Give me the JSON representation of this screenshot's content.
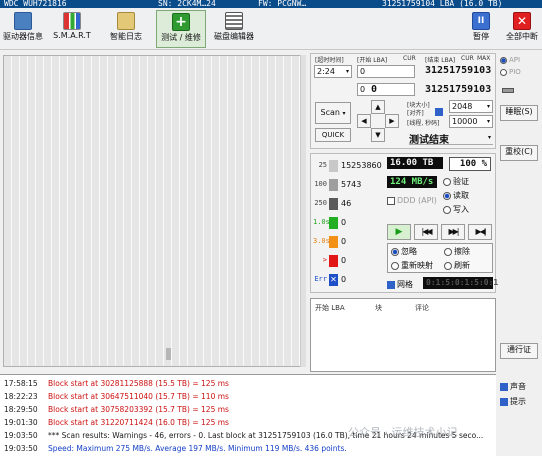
{
  "infobar": {
    "model": "WDC WUH721816",
    "sn": "SN: 2CK4M…24",
    "fw": "FW: PCGNW…",
    "capacity": "31251759104 LBA (16.0 TB)"
  },
  "toolbar": {
    "buttons": [
      {
        "label": "驱动器信息",
        "icon": "drive-info-icon"
      },
      {
        "label": "S.M.A.R.T",
        "icon": "smart-icon"
      },
      {
        "label": "智能日志",
        "icon": "log-icon"
      },
      {
        "label": "测试 / 维修",
        "icon": "test-repair-icon"
      },
      {
        "label": "磁盘编辑器",
        "icon": "disk-editor-icon"
      },
      {
        "label": "暂停",
        "icon": "pause-icon"
      },
      {
        "label": "全部中断",
        "icon": "stop-icon"
      }
    ]
  },
  "controls": {
    "timeout_label": "[超时时间]",
    "timeout_value": "2:24",
    "start_lba_label": "[开始 LBA]",
    "start_lba_value": "0",
    "start_lba_zero": "0",
    "end_lba_label": "[结束 LBA]",
    "end_lba_value": "31251759103",
    "end_lba_readout": "31251759103",
    "start_lba_readout": "0",
    "cur_label": "CUR",
    "max_label": "MAX",
    "scan_button": "Scan",
    "quick_button": "QUICK",
    "block_size_label": "[块大小]",
    "align_label": "[对齐]",
    "block_size_value": "2048",
    "threads_label": "[线程, 秒码]",
    "threads_value": "10000",
    "status_text": "测试结束"
  },
  "stats": {
    "capacity_readout": "16.00 TB",
    "percent_readout": "100 %",
    "speed_readout": "124 MB/s",
    "legend": [
      {
        "label": "25",
        "value": "15253860",
        "color": "#c8c8c8"
      },
      {
        "label": "100",
        "value": "5743",
        "color": "#9e9e9e"
      },
      {
        "label": "250",
        "value": "46",
        "color": "#5a5a5a"
      },
      {
        "label": "1.0s",
        "value": "0",
        "color": "#22b022"
      },
      {
        "label": "3.0s",
        "value": "0",
        "color": "#f29018"
      },
      {
        "label": ">",
        "value": "0",
        "color": "#e01818"
      },
      {
        "label": "Err",
        "value": "0",
        "color": "#1f4fc8"
      }
    ],
    "mode_verify": "验证",
    "mode_read": "读取",
    "mode_write": "写入",
    "ddd_label": "DDD (API)"
  },
  "repair": {
    "ignore": "忽略",
    "erase": "擦除",
    "remap": "重新映射",
    "refresh": "刷新",
    "grid_label": "网格",
    "grid_readout": "0:1:5:0:1:5:0:1"
  },
  "table": {
    "col_lba": "开始 LBA",
    "col_block": "块",
    "col_note": "评论"
  },
  "side": {
    "api_label": "API",
    "pio_label": "PIO",
    "sleep_button": "睡眠(S)",
    "recal_button": "重校(C)",
    "passport_button": "通行证",
    "sound_label": "声音",
    "hints_label": "提示"
  },
  "log": [
    {
      "time": "17:58:15",
      "msg": "Block start at 30281125888 (15.5 TB)  = 125 ms",
      "kind": "warn"
    },
    {
      "time": "18:22:23",
      "msg": "Block start at 30647511040 (15.7 TB)  = 110 ms",
      "kind": "warn"
    },
    {
      "time": "18:29:50",
      "msg": "Block start at 30758203392 (15.7 TB)  = 125 ms",
      "kind": "warn"
    },
    {
      "time": "19:01:30",
      "msg": "Block start at 31220711424 (16.0 TB)  = 125 ms",
      "kind": "warn"
    },
    {
      "time": "19:03:50",
      "msg": "*** Scan results: Warnings - 46, errors - 0. Last block at 31251759103 (16.0 TB), time 21 hours 24 minutes 5 seco...",
      "kind": "summary"
    },
    {
      "time": "19:03:50",
      "msg": "Speed: Maximum 275 MB/s. Average 197 MB/s. Minimum 119 MB/s. 436 points.",
      "kind": "speed"
    }
  ],
  "watermark": "公众号 · 运维技术小记"
}
